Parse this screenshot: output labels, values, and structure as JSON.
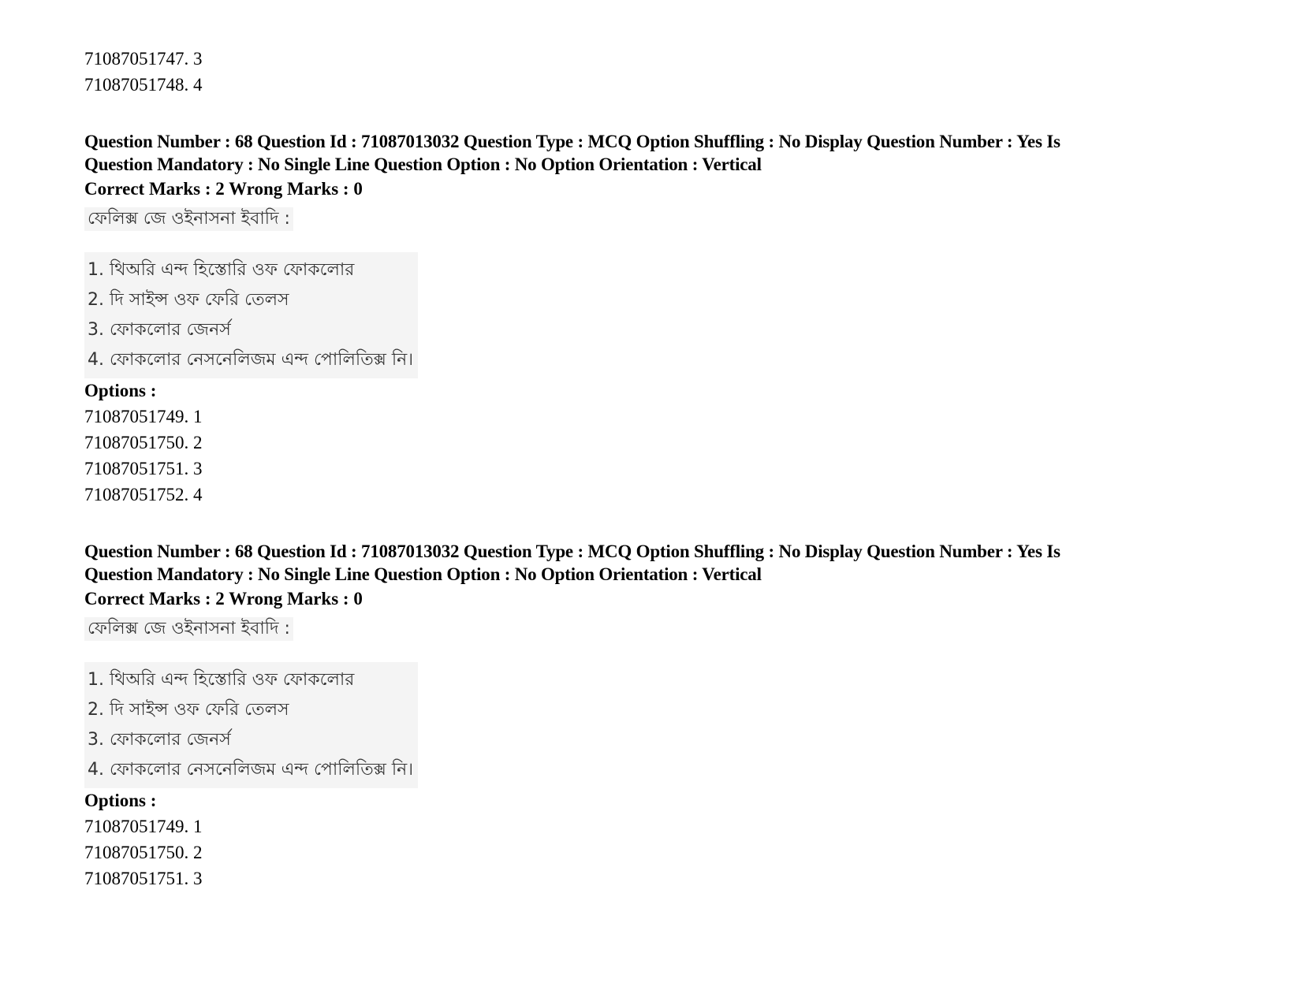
{
  "prev_options": [
    {
      "id": "71087051747",
      "label": "3"
    },
    {
      "id": "71087051748",
      "label": "4"
    }
  ],
  "questions": [
    {
      "meta_line1": "Question Number : 68 Question Id : 71087013032 Question Type : MCQ Option Shuffling : No Display Question Number : Yes Is",
      "meta_line2": "Question Mandatory : No Single Line Question Option : No Option Orientation : Vertical",
      "marks": "Correct Marks : 2 Wrong Marks : 0",
      "stem": "ফেলিক্স জে ওইনাসনা ইবাদি :",
      "choices": [
        "1. থিঅরি এন্দ হিস্তোরি ওফ ফোকলোর",
        "2. দি সাইন্স ওফ ফেরি তেলস",
        "3. ফোকলোর জেনর্স",
        "4. ফোকলোর নেসনেলিজম এন্দ পোলিতিক্স     নি।"
      ],
      "options_heading": "Options :",
      "options": [
        {
          "id": "71087051749",
          "label": "1"
        },
        {
          "id": "71087051750",
          "label": "2"
        },
        {
          "id": "71087051751",
          "label": "3"
        },
        {
          "id": "71087051752",
          "label": "4"
        }
      ]
    },
    {
      "meta_line1": "Question Number : 68 Question Id : 71087013032 Question Type : MCQ Option Shuffling : No Display Question Number : Yes Is",
      "meta_line2": "Question Mandatory : No Single Line Question Option : No Option Orientation : Vertical",
      "marks": "Correct Marks : 2 Wrong Marks : 0",
      "stem": "ফেলিক্স জে ওইনাসনা ইবাদি :",
      "choices": [
        "1. থিঅরি এন্দ হিস্তোরি ওফ ফোকলোর",
        "2. দি সাইন্স ওফ ফেরি তেলস",
        "3. ফোকলোর জেনর্স",
        "4. ফোকলোর নেসনেলিজম এন্দ পোলিতিক্স     নি।"
      ],
      "options_heading": "Options :",
      "options": [
        {
          "id": "71087051749",
          "label": "1"
        },
        {
          "id": "71087051750",
          "label": "2"
        },
        {
          "id": "71087051751",
          "label": "3"
        }
      ]
    }
  ]
}
